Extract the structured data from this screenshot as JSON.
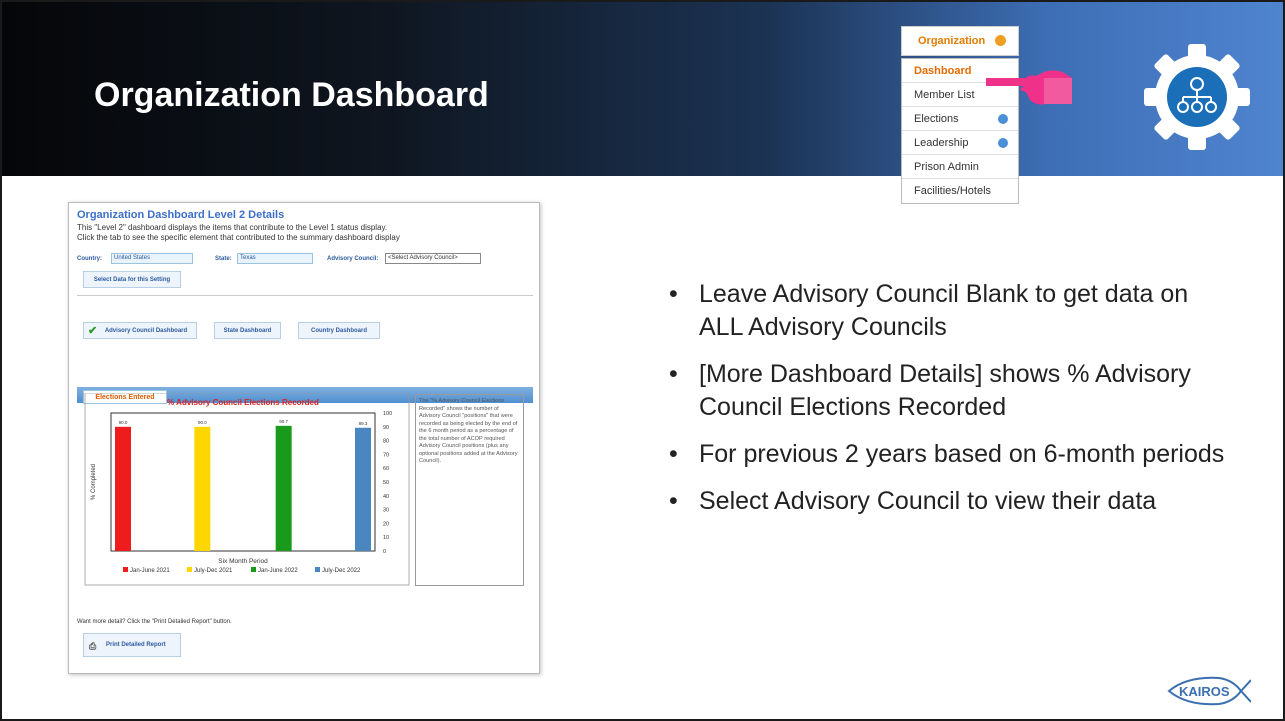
{
  "slide": {
    "title": "Organization Dashboard",
    "colors": {
      "header_dark": "#050608",
      "header_blue": "#4f84cf",
      "accent_orange": "#e86a00",
      "hand_pink": "#f0318a"
    }
  },
  "nav_menu": {
    "top_tab": "Organization",
    "items": [
      {
        "label": "Dashboard",
        "active": true
      },
      {
        "label": "Member List"
      },
      {
        "label": "Elections",
        "has_submenu": true
      },
      {
        "label": "Leadership",
        "has_submenu": true
      },
      {
        "label": "Prison Admin"
      },
      {
        "label": "Facilities/Hotels"
      }
    ]
  },
  "icons": [
    "pointing-hand-icon",
    "gear-org-chart-icon",
    "kairos-logo"
  ],
  "screenshot": {
    "heading": "Organization Dashboard Level 2 Details",
    "lines": [
      "This \"Level 2\" dashboard displays the items that contribute to the Level 1 status display.",
      "Click the tab to see the specific element that contributed to the summary dashboard display"
    ],
    "country_label": "Country:",
    "country_value": "United States",
    "state_label": "State:",
    "state_value": "Texas",
    "council_label": "Advisory Council:",
    "council_value": "<Select Advisory Council>",
    "select_button": "Select Data for this Setting",
    "dash_buttons": [
      "Advisory Council Dashboard",
      "State Dashboard",
      "Country Dashboard"
    ],
    "tab_label": "Elections Entered",
    "description": "The \"% Advisory Council Elections Recorded\" shows the number of Advisory Council \"positions\" that were recorded as being elected by the end of the 6 month period as a percentage of the total number of ACOP required Advisory Council positions (plus any optional positions added at the Advisory Council).",
    "note": "Want more detail? Click the \"Print Detailed Report\" button.",
    "print_button": "Print Detailed Report"
  },
  "chart_data": {
    "type": "bar",
    "title": "% Advisory Council Elections Recorded",
    "xlabel": "Six Month Period",
    "ylabel": "% Completed",
    "ylim": [
      0,
      100
    ],
    "yticks": [
      0,
      10,
      20,
      30,
      40,
      50,
      60,
      70,
      80,
      90,
      100
    ],
    "categories": [
      "Jan-June 2021",
      "July-Dec 2021",
      "Jan-June 2022",
      "July-Dec 2022"
    ],
    "values": [
      90.0,
      90.0,
      90.7,
      89.3
    ],
    "value_labels": [
      "90.0",
      "90.0",
      "90.7",
      "89.3"
    ],
    "colors": [
      "#ee1c1c",
      "#ffd600",
      "#1a9a1a",
      "#4a86c0"
    ],
    "legend": "bottom"
  },
  "bullets": [
    "Leave Advisory Council Blank to get data on ALL Advisory Councils",
    "[More Dashboard Details] shows % Advisory Council Elections Recorded",
    "For previous 2 years based on 6-month periods",
    "Select Advisory Council to view their data"
  ]
}
